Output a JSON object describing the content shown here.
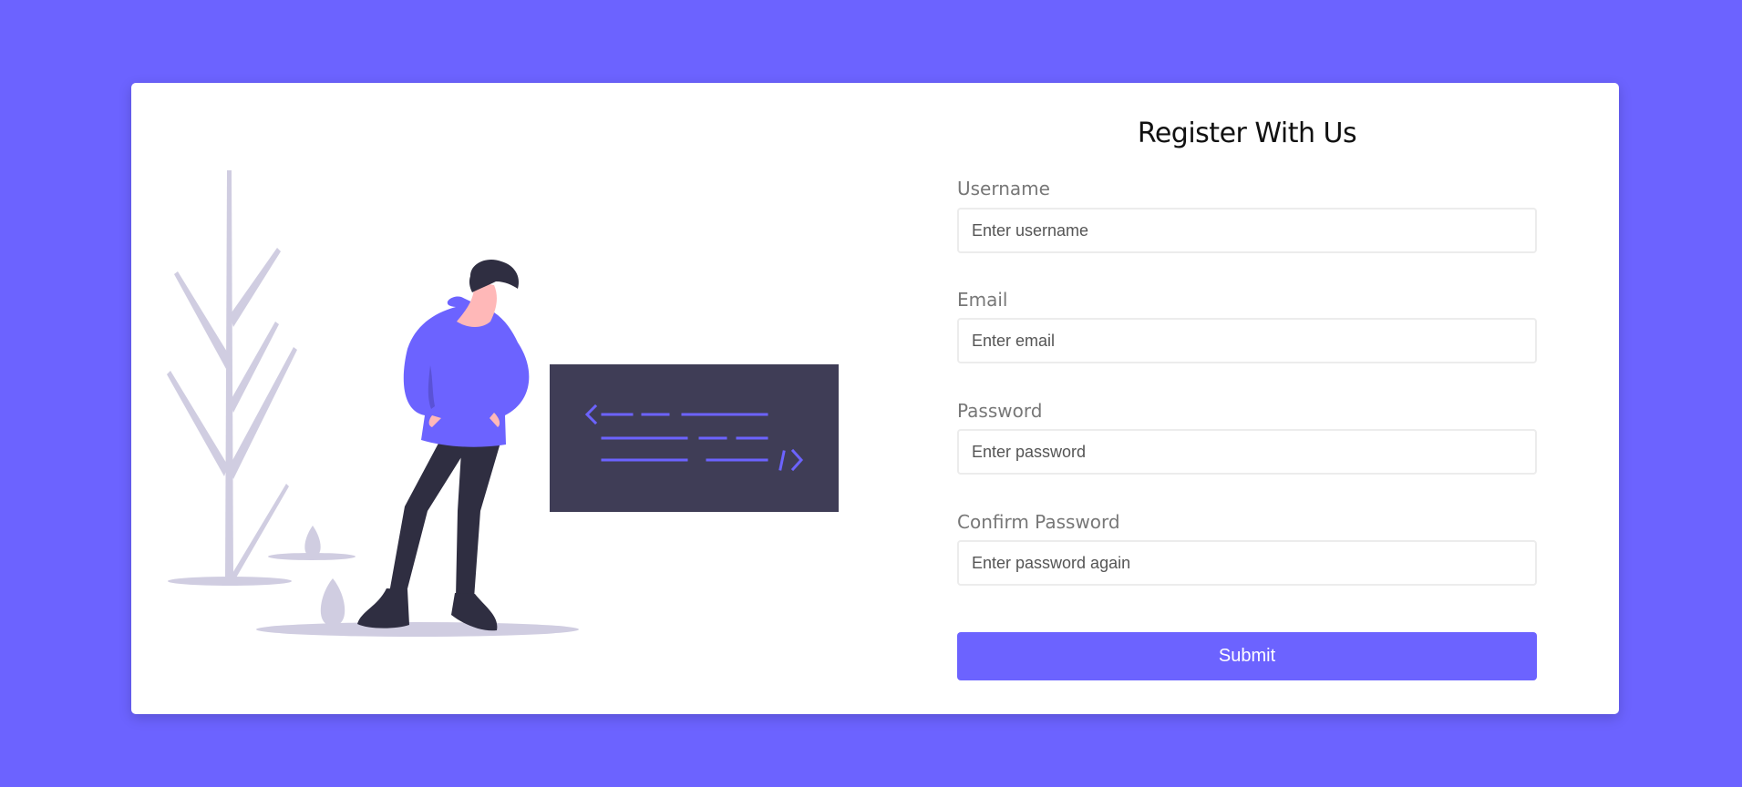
{
  "form": {
    "title": "Register With Us",
    "fields": [
      {
        "label": "Username",
        "placeholder": "Enter username",
        "value": ""
      },
      {
        "label": "Email",
        "placeholder": "Enter email",
        "value": ""
      },
      {
        "label": "Password",
        "placeholder": "Enter password",
        "value": ""
      },
      {
        "label": "Confirm Password",
        "placeholder": "Enter password again",
        "value": ""
      }
    ],
    "submit_label": "Submit"
  },
  "illustration": {
    "icon": "developer-illustration",
    "code_symbol": "< />"
  },
  "colors": {
    "background": "#6c63ff",
    "accent": "#6c63ff",
    "card": "#ffffff",
    "code_board": "#3f3d56",
    "plant": "#d0cde1"
  }
}
